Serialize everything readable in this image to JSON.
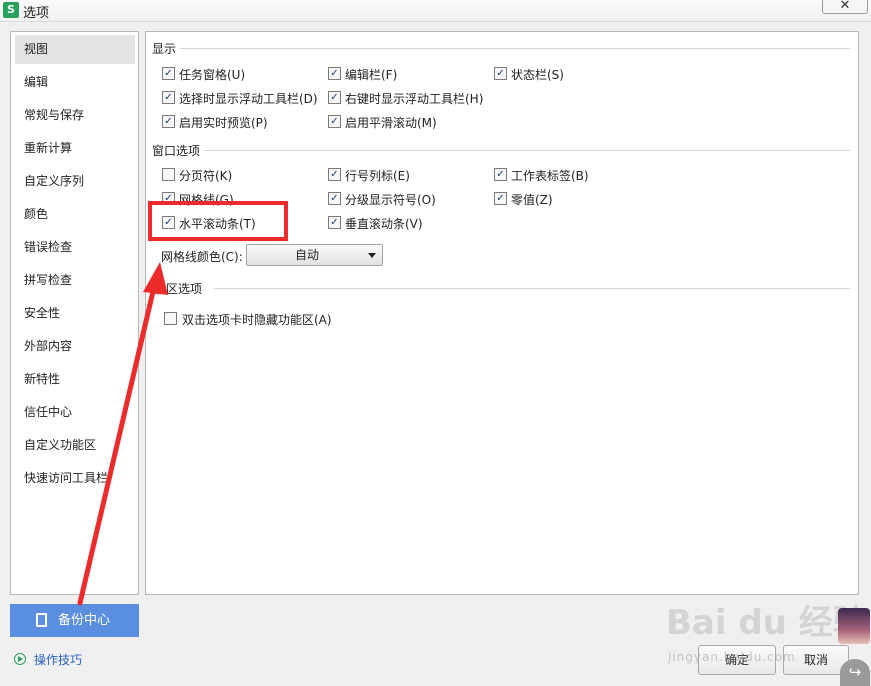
{
  "window": {
    "title": "选项",
    "app_icon": "wps-spreadsheet-icon"
  },
  "sidebar": {
    "active_index": 0,
    "items": [
      {
        "label": "视图"
      },
      {
        "label": "编辑"
      },
      {
        "label": "常规与保存"
      },
      {
        "label": "重新计算"
      },
      {
        "label": "自定义序列"
      },
      {
        "label": "颜色"
      },
      {
        "label": "错误检查"
      },
      {
        "label": "拼写检查"
      },
      {
        "label": "安全性"
      },
      {
        "label": "外部内容"
      },
      {
        "label": "新特性"
      },
      {
        "label": "信任中心"
      },
      {
        "label": "自定义功能区"
      },
      {
        "label": "快速访问工具栏"
      }
    ]
  },
  "display": {
    "title": "显示",
    "options": [
      {
        "label": "任务窗格(U)",
        "checked": true
      },
      {
        "label": "编辑栏(F)",
        "checked": true
      },
      {
        "label": "状态栏(S)",
        "checked": true
      },
      {
        "label": "选择时显示浮动工具栏(D)",
        "checked": true
      },
      {
        "label": "右键时显示浮动工具栏(H)",
        "checked": true
      },
      {
        "label": "启用实时预览(P)",
        "checked": true
      },
      {
        "label": "启用平滑滚动(M)",
        "checked": true
      }
    ]
  },
  "window_options": {
    "title": "窗口选项",
    "options": [
      {
        "label": "分页符(K)",
        "checked": false
      },
      {
        "label": "行号列标(E)",
        "checked": true
      },
      {
        "label": "工作表标签(B)",
        "checked": true
      },
      {
        "label": "网格线(G)",
        "checked": true
      },
      {
        "label": "分级显示符号(O)",
        "checked": true
      },
      {
        "label": "零值(Z)",
        "checked": true
      },
      {
        "label": "水平滚动条(T)",
        "checked": true
      },
      {
        "label": "垂直滚动条(V)",
        "checked": true
      }
    ],
    "gridline_color_label": "网格线颜色(C):",
    "gridline_color_value": "自动"
  },
  "ribbon": {
    "title": "能区选项",
    "options": [
      {
        "label": "双击选项卡时隐藏功能区(A)",
        "checked": false
      }
    ]
  },
  "footer": {
    "backup_label": "备份中心",
    "tips_label": "操作技巧",
    "ok_label": "确定",
    "cancel_label": "取消"
  },
  "overlay": {
    "watermark": "Bai du 经验",
    "watermark_url": "jingyan.baidu.com",
    "highlight_color": "#ee2b2b"
  }
}
